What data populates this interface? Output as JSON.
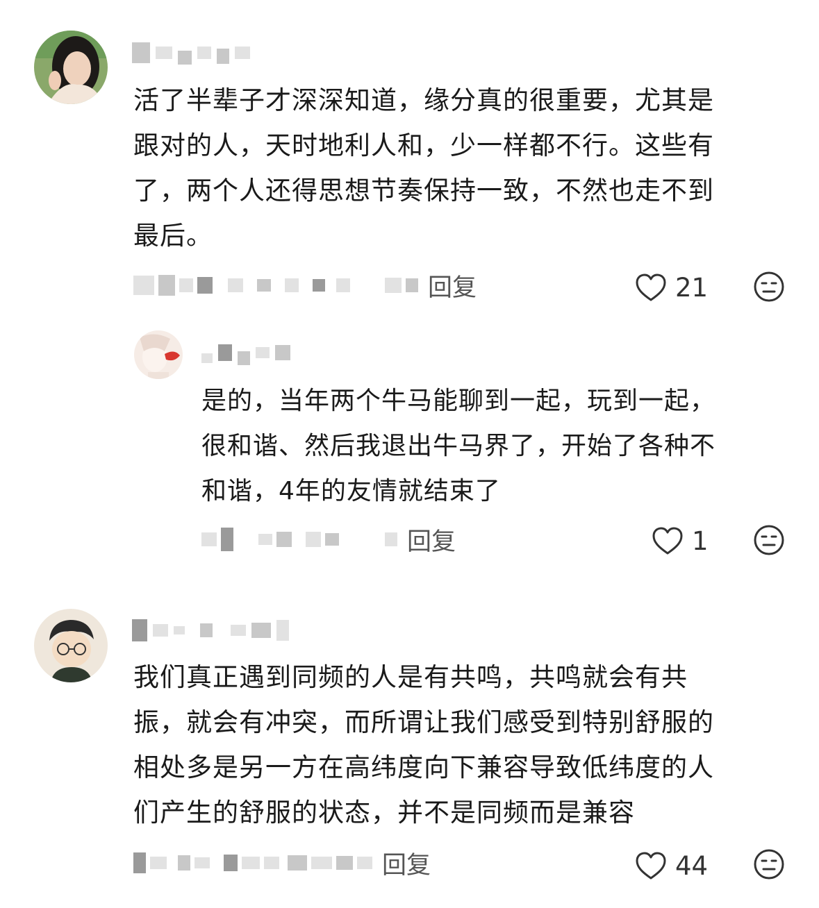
{
  "comments": [
    {
      "text": "活了半辈子才深深知道，缘分真的很重要，尤其是\n跟对的人，天时地利人和，少一样都不行。这些有\n了，两个人还得思想节奏保持一致，不然也走不到\n最后。",
      "reply_label": "回复",
      "likes": "21",
      "like_icon": "heart-outline-icon",
      "dislike_icon": "meh-face-icon",
      "reply": {
        "text": "是的，当年两个牛马能聊到一起，玩到一起，\n很和谐、然后我退出牛马界了，开始了各种不\n和谐，4年的友情就结束了",
        "reply_label": "回复",
        "likes": "1"
      }
    },
    {
      "text": "我们真正遇到同频的人是有共鸣，共鸣就会有共\n振，就会有冲突，而所谓让我们感受到特别舒服的\n相处多是另一方在高纬度向下兼容导致低纬度的人\n们产生的舒服的状态，并不是同频而是兼容",
      "reply_label": "回复",
      "likes": "44"
    }
  ],
  "colors": {
    "text": "#1a1a1a",
    "meta": "#555555",
    "icon": "#333333",
    "blur": "#c8c8c8"
  }
}
